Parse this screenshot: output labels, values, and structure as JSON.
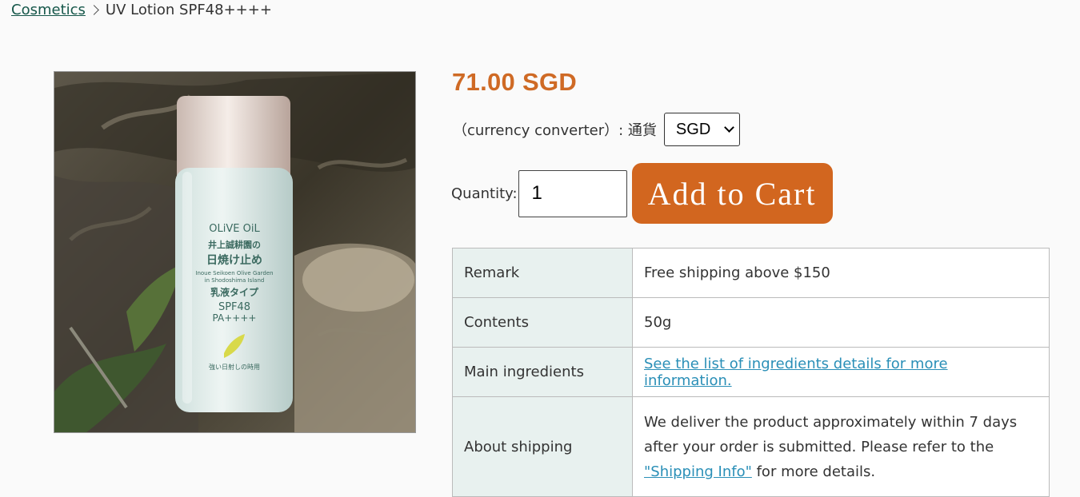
{
  "breadcrumb": {
    "category": "Cosmetics",
    "current": "UV Lotion SPF48++++"
  },
  "product": {
    "image_alt": "UV Lotion SPF48++++ bottle",
    "bottle_brand": "OLiVE OiL",
    "bottle_jp_line1": "井上誠耕園の",
    "bottle_jp_line2": "日焼け止め",
    "bottle_en": "Inoue Seikoen Olive Garden",
    "bottle_en2": "in Shodoshima Island",
    "bottle_type": "乳液タイプ",
    "bottle_spf": "SPF48",
    "bottle_pa": "PA++++",
    "bottle_bottom": "強い日射しの時用"
  },
  "price": "71.00 SGD",
  "currency": {
    "label": "（currency converter）: 通貨",
    "selected": "SGD"
  },
  "quantity": {
    "label": "Quantity:",
    "value": "1"
  },
  "cart_button": "Add to Cart",
  "specs": [
    {
      "key": "Remark",
      "value": "Free shipping above $150"
    },
    {
      "key": "Contents",
      "value": "50g"
    },
    {
      "key": "Main ingredients",
      "link": "See the list of ingredients details for more information."
    },
    {
      "key": "About shipping",
      "text_before": "We deliver the product approximately within 7 days after your order is submitted. Please refer to the ",
      "link": "\"Shipping Info\"",
      "text_after": " for more details."
    }
  ],
  "colors": {
    "price": "#cf6a25",
    "cart_button": "#d2661f",
    "table_key_bg": "#e8f1ef",
    "link": "#2a8fb7",
    "breadcrumb_link": "#16574a"
  }
}
